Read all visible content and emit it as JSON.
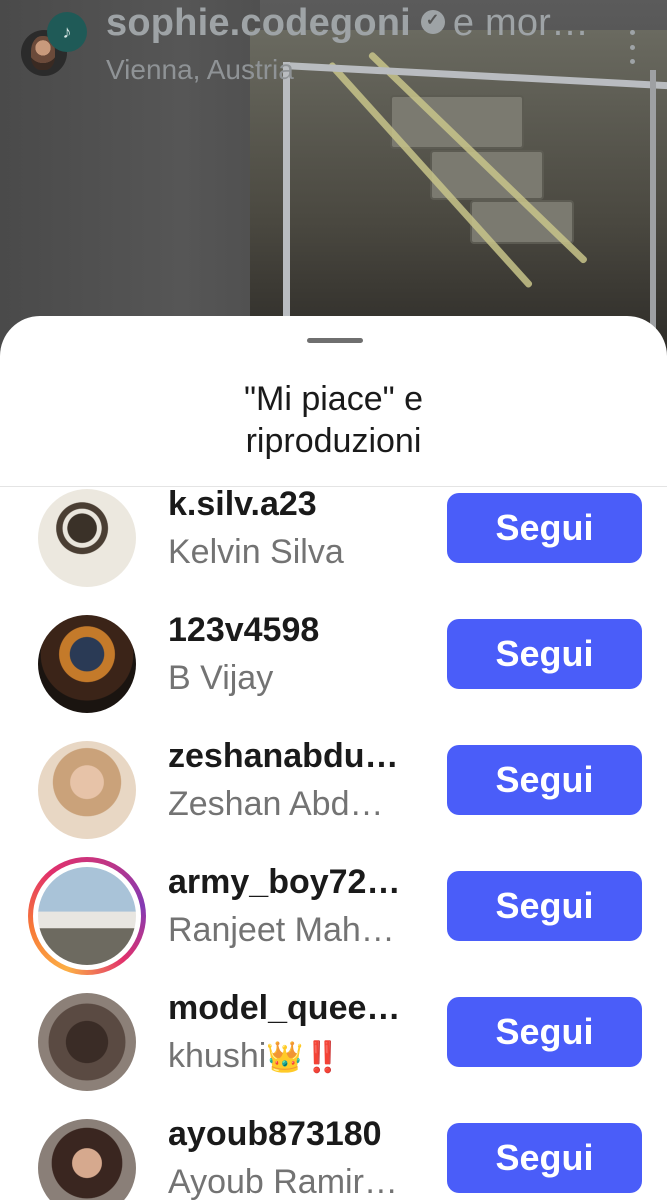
{
  "reel": {
    "username": "sophie.codegoni",
    "header_suffix": "e mor…",
    "location": "Vienna, Austria"
  },
  "sheet": {
    "title_line1": "\"Mi piace\" e",
    "title_line2": "riproduzioni"
  },
  "likers": [
    {
      "username": "k.silv.a23",
      "name": "Kelvin Silva",
      "button": "Segui"
    },
    {
      "username": "123v4598",
      "name": "B Vijay",
      "button": "Segui"
    },
    {
      "username": "zeshanabdu…",
      "name": "Zeshan Abd…",
      "button": "Segui"
    },
    {
      "username": "army_boy72…",
      "name": "Ranjeet Mah…",
      "button": "Segui"
    },
    {
      "username": "model_quee…",
      "name": "khushi",
      "name_emoji": "👑‼️",
      "button": "Segui"
    },
    {
      "username": "ayoub873180",
      "name": "Ayoub Ramir…",
      "button": "Segui"
    }
  ],
  "colors": {
    "follow_button": "#4a5df9",
    "story_ring": "#e1306c"
  },
  "icons": [
    "music-badge-icon",
    "verified-icon",
    "more-options-icon"
  ]
}
